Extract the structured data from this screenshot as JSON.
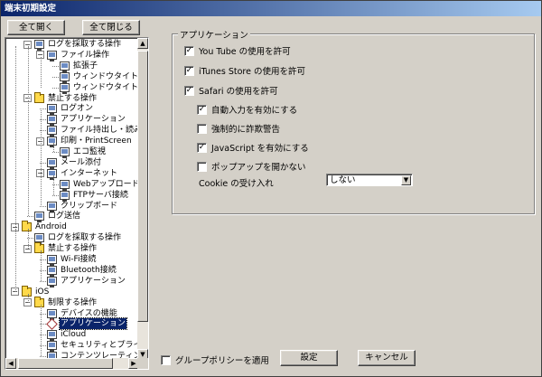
{
  "window": {
    "title": "端末初期設定"
  },
  "toolbar": {
    "expand_all": "全て開く",
    "collapse_all": "全て閉じる"
  },
  "tree": [
    {
      "label": "ログを採取する操作",
      "icon": "pc-icon"
    },
    {
      "label": "ファイル操作",
      "icon": "pc-icon"
    },
    {
      "label": "拡張子",
      "icon": "pc-icon"
    },
    {
      "label": "ウィンドウタイトルフィル",
      "icon": "pc-icon"
    },
    {
      "label": "ウィンドウタイトル画面キ",
      "icon": "pc-icon"
    },
    {
      "label": "禁止する操作",
      "icon": "folder-icon"
    },
    {
      "label": "ログオン",
      "icon": "pc-icon"
    },
    {
      "label": "アプリケーション",
      "icon": "pc-icon"
    },
    {
      "label": "ファイル持出し・読み込",
      "icon": "pc-icon"
    },
    {
      "label": "印刷・PrintScreen",
      "icon": "pc-icon"
    },
    {
      "label": "エコ監視",
      "icon": "pc-icon"
    },
    {
      "label": "メール添付",
      "icon": "pc-icon"
    },
    {
      "label": "インターネット",
      "icon": "pc-icon"
    },
    {
      "label": "Webアップロード・ダ",
      "icon": "pc-icon"
    },
    {
      "label": "FTPサーバ接続",
      "icon": "pc-icon"
    },
    {
      "label": "クリップボード",
      "icon": "pc-icon"
    },
    {
      "label": "ログ送信",
      "icon": "pc-icon"
    },
    {
      "label": "Android",
      "icon": "folder-icon"
    },
    {
      "label": "ログを採取する操作",
      "icon": "pc-icon"
    },
    {
      "label": "禁止する操作",
      "icon": "folder-icon"
    },
    {
      "label": "Wi-Fi接続",
      "icon": "pc-icon"
    },
    {
      "label": "Bluetooth接続",
      "icon": "pc-icon"
    },
    {
      "label": "アプリケーション",
      "icon": "pc-icon"
    },
    {
      "label": "iOS",
      "icon": "folder-icon"
    },
    {
      "label": "制限する操作",
      "icon": "folder-icon"
    },
    {
      "label": "デバイスの機能",
      "icon": "pc-icon"
    },
    {
      "label": "アプリケーション",
      "icon": "diamond-icon"
    },
    {
      "label": "iCloud",
      "icon": "pc-icon"
    },
    {
      "label": "セキュリティとプライバシ",
      "icon": "pc-icon"
    },
    {
      "label": "コンテンツレーティング",
      "icon": "pc-icon"
    }
  ],
  "panel": {
    "group_title": "アプリケーション",
    "allow_youtube": {
      "label": "You Tube の使用を許可",
      "checked": true
    },
    "allow_itunes": {
      "label": "iTunes Store の使用を許可",
      "checked": true
    },
    "allow_safari": {
      "label": "Safari の使用を許可",
      "checked": true
    },
    "autofill": {
      "label": "自動入力を有効にする",
      "checked": true
    },
    "fraud_warning": {
      "label": "強制的に詐欺警告",
      "checked": false
    },
    "javascript": {
      "label": "JavaScript を有効にする",
      "checked": true
    },
    "block_popups": {
      "label": "ポップアップを開かない",
      "checked": false
    },
    "cookie_label": "Cookie の受け入れ",
    "cookie_value": "しない"
  },
  "footer": {
    "apply_group_policy": {
      "label": "グループポリシーを適用",
      "checked": false
    },
    "ok": "設定",
    "cancel": "キャンセル"
  },
  "colors": {
    "selection": "#0a246a",
    "face": "#d4d0c8"
  }
}
